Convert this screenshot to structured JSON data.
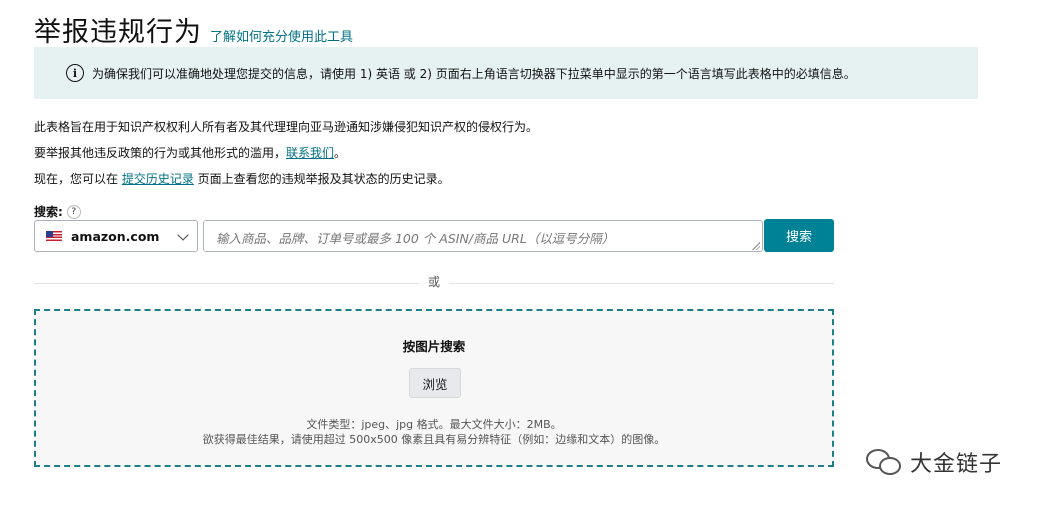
{
  "header": {
    "title": "举报违规行为",
    "help_link": "了解如何充分使用此工具"
  },
  "notice": {
    "icon": "info-icon",
    "icon_glyph": "i",
    "text": "为确保我们可以准确地处理您提交的信息，请使用 1) 英语 或 2) 页面右上角语言切换器下拉菜单中显示的第一个语言填写此表格中的必填信息。"
  },
  "description": {
    "line1": "此表格旨在用于知识产权权利人所有者及其代理理向亚马逊通知涉嫌侵犯知识产权的侵权行为。",
    "line2_prefix": "要举报其他违反政策的行为或其他形式的滥用，",
    "line2_link": "联系我们",
    "line2_suffix": "。",
    "line3_prefix": "现在，您可以在 ",
    "line3_link": "提交历史记录",
    "line3_suffix": " 页面上查看您的违规举报及其状态的历史记录。"
  },
  "search": {
    "label": "搜索:",
    "help_glyph": "?",
    "marketplace": "amazon.com",
    "placeholder": "输入商品、品牌、订单号或最多 100 个 ASIN/商品 URL（以逗号分隔）",
    "button": "搜索"
  },
  "divider": {
    "or": "或"
  },
  "image_search": {
    "title": "按图片搜索",
    "browse": "浏览",
    "file_types": "文件类型：jpeg、jpg 格式。最大文件大小：2MB。",
    "tip": "欲获得最佳结果，请使用超过 500x500 像素且具有易分辨特征（例如：边缘和文本）的图像。"
  },
  "watermark": {
    "text": "大金链子"
  },
  "colors": {
    "link": "#007185",
    "button": "#008296",
    "notice_bg": "#e6f2f2",
    "dropzone_border": "#1e7f8a"
  }
}
